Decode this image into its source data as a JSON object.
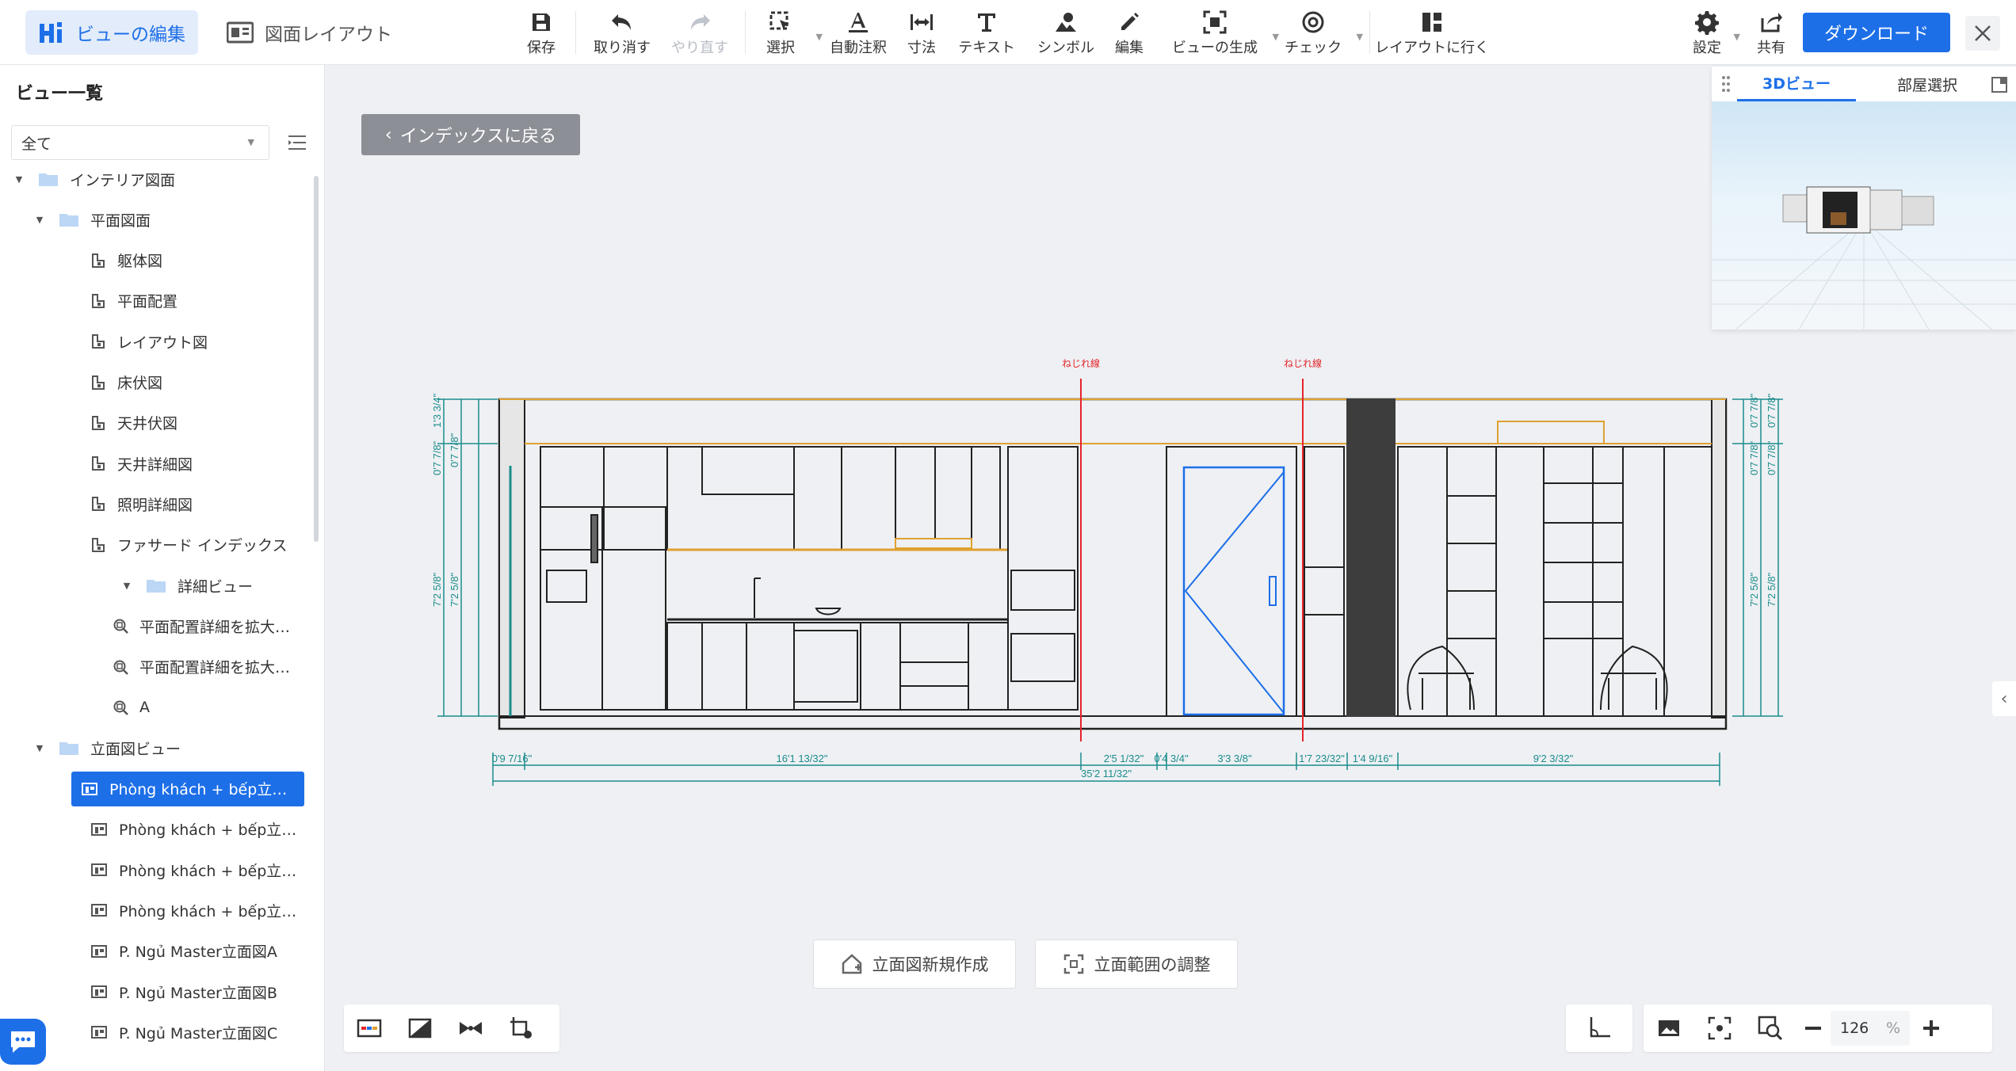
{
  "toolbar": {
    "tab_edit": "ビューの編集",
    "tab_layout": "図面レイアウト",
    "tools": [
      {
        "label": "保存",
        "icon": "save-icon"
      },
      {
        "label": "取り消す",
        "icon": "undo-icon"
      },
      {
        "label": "やり直す",
        "icon": "redo-icon"
      },
      {
        "label": "選択",
        "icon": "select-icon"
      },
      {
        "label": "自動注釈",
        "icon": "auto-annotate-icon"
      },
      {
        "label": "寸法",
        "icon": "dimension-icon"
      },
      {
        "label": "テキスト",
        "icon": "text-icon"
      },
      {
        "label": "シンボル",
        "icon": "symbol-icon"
      },
      {
        "label": "編集",
        "icon": "edit-icon"
      },
      {
        "label": "ビューの生成",
        "icon": "generate-view-icon"
      },
      {
        "label": "チェック",
        "icon": "check-icon"
      },
      {
        "label": "レイアウトに行く",
        "icon": "go-layout-icon"
      }
    ],
    "settings": "設定",
    "share": "共有",
    "download": "ダウンロード"
  },
  "sidebar": {
    "title": "ビュー一覧",
    "filter_value": "全て",
    "tree": [
      {
        "label": "インテリア図面",
        "level": 0,
        "type": "folder",
        "expanded": true
      },
      {
        "label": "平面図面",
        "level": 1,
        "type": "folder",
        "expanded": true
      },
      {
        "label": "躯体図",
        "level": 2,
        "type": "plan"
      },
      {
        "label": "平面配置",
        "level": 2,
        "type": "plan"
      },
      {
        "label": "レイアウト図",
        "level": 2,
        "type": "plan"
      },
      {
        "label": "床伏図",
        "level": 2,
        "type": "plan"
      },
      {
        "label": "天井伏図",
        "level": 2,
        "type": "plan"
      },
      {
        "label": "天井詳細図",
        "level": 2,
        "type": "plan"
      },
      {
        "label": "照明詳細図",
        "level": 2,
        "type": "plan"
      },
      {
        "label": "ファサード インデックス",
        "level": 2,
        "type": "plan"
      },
      {
        "label": "詳細ビュー",
        "level": 2,
        "type": "folder",
        "expanded": true
      },
      {
        "label": "平面配置詳細を拡大…",
        "level": 3,
        "type": "detail"
      },
      {
        "label": "平面配置詳細を拡大…",
        "level": 3,
        "type": "detail"
      },
      {
        "label": "A",
        "level": 3,
        "type": "detail"
      },
      {
        "label": "立面図ビュー",
        "level": 1,
        "type": "folder",
        "expanded": true
      },
      {
        "label": "Phòng khách + bếp立…",
        "level": 2,
        "type": "elevation",
        "selected": true
      },
      {
        "label": "Phòng khách + bếp立…",
        "level": 2,
        "type": "elevation"
      },
      {
        "label": "Phòng khách + bếp立…",
        "level": 2,
        "type": "elevation"
      },
      {
        "label": "Phòng khách + bếp立…",
        "level": 2,
        "type": "elevation"
      },
      {
        "label": "P. Ngủ Master立面図A",
        "level": 2,
        "type": "elevation"
      },
      {
        "label": "P. Ngủ Master立面図B",
        "level": 2,
        "type": "elevation"
      },
      {
        "label": "P. Ngủ Master立面図C",
        "level": 2,
        "type": "elevation"
      }
    ]
  },
  "canvas": {
    "back_button": "インデックスに戻る",
    "new_elevation": "立面図新規作成",
    "adjust_range": "立面範囲の調整",
    "zoom": "126",
    "zoom_unit": "%"
  },
  "drawing": {
    "twist_label_1": "ねじれ線",
    "twist_label_2": "ねじれ線",
    "bottom_dims": [
      "0'9 7/16\"",
      "16'1 13/32\"",
      "2'5 1/32\"",
      "0'4 3/4\"",
      "3'3 3/8\"",
      "1'7 23/32\"",
      "1'4 9/16\"",
      "9'2 3/32\""
    ],
    "total_dim": "35'2 11/32\"",
    "left_dims": [
      "0'7 7/8\"",
      "1'3 3/4\"",
      "0'7 7/8\"",
      "7'2 5/8\"",
      "7'2 5/8\""
    ],
    "right_dims": [
      "0'7 7/8\"",
      "0'7 7/8\"",
      "0'7 7/8\"",
      "0'7 7/8\"",
      "7'2 5/8\"",
      "7'2 5/8\""
    ]
  },
  "preview": {
    "tab_3d": "3Dビュー",
    "tab_room": "部屋選択"
  },
  "colors": {
    "accent": "#1d6fe8",
    "dimension": "#1a8c8c",
    "twist_line": "#e5252a",
    "ceiling_line": "#e0a030"
  }
}
